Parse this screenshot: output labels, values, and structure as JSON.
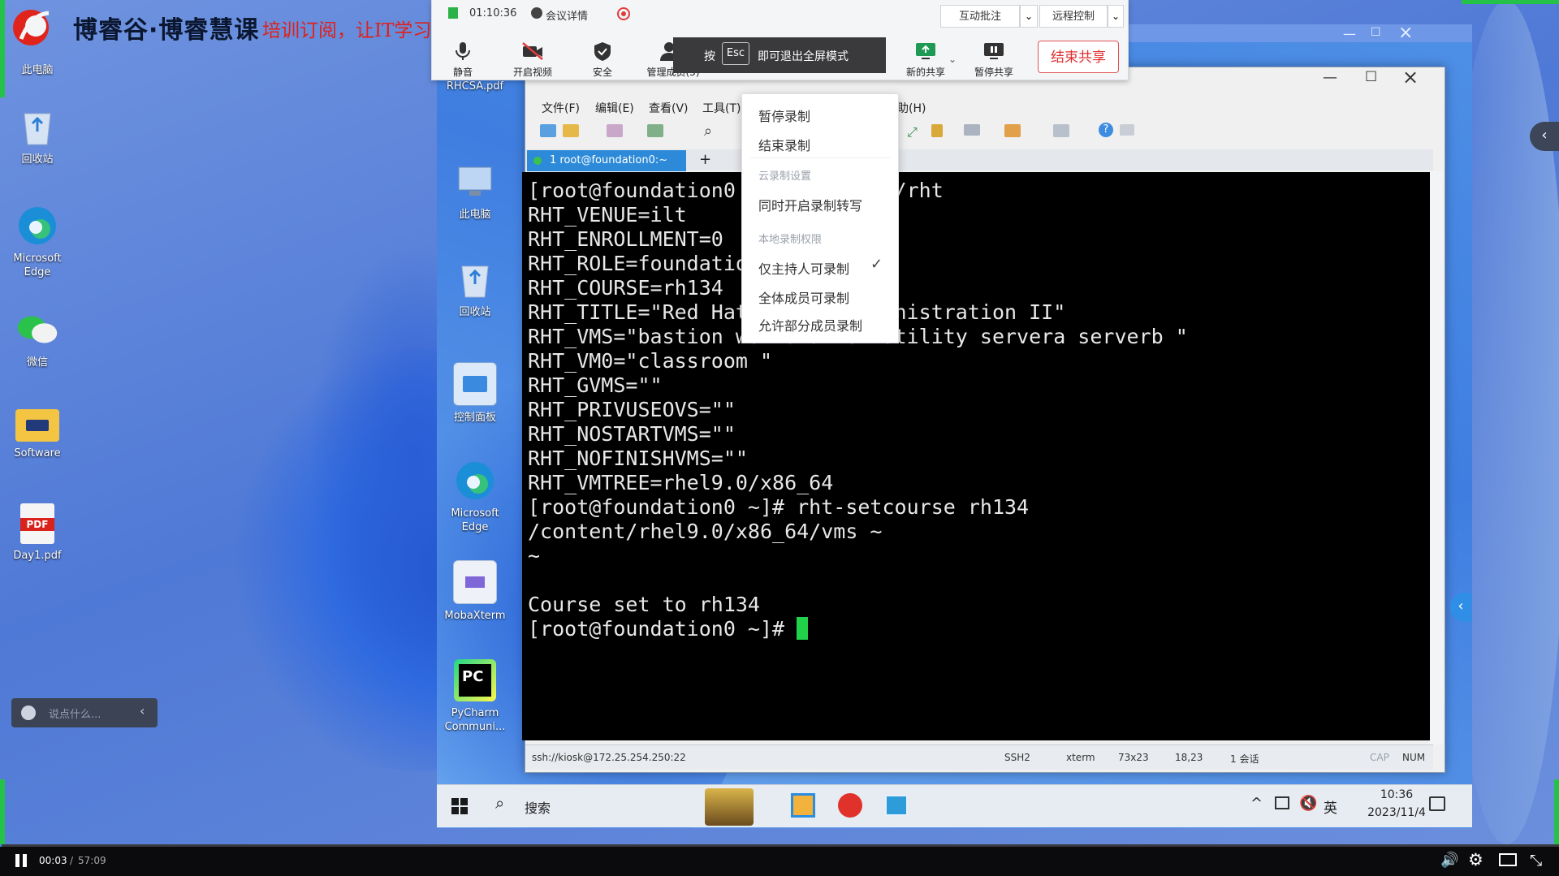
{
  "brand": {
    "name": "博睿谷·博睿慧课",
    "slogan": "培训订阅，让IT学习更普惠便捷"
  },
  "outer_desktop_icons": [
    {
      "label": "此电脑",
      "icon": "computer-icon"
    },
    {
      "label": "回收站",
      "icon": "recycle-bin-icon"
    },
    {
      "label": "Microsoft Edge",
      "icon": "edge-icon"
    },
    {
      "label": "微信",
      "icon": "wechat-icon"
    },
    {
      "label": "Software",
      "icon": "folder-icon"
    },
    {
      "label": "Day1.pdf",
      "icon": "pdf-icon"
    }
  ],
  "chat_bar": {
    "placeholder": "说点什么..."
  },
  "meeting_toolbar": {
    "timer": "01:10:36",
    "meeting_info": "会议详情",
    "buttons": [
      {
        "label": "静音",
        "icon": "microphone-icon"
      },
      {
        "label": "开启视频",
        "icon": "camera-off-icon"
      },
      {
        "label": "安全",
        "icon": "shield-icon"
      },
      {
        "label": "管理成员(3)",
        "icon": "members-icon"
      },
      {
        "label": "新的共享",
        "icon": "share-screen-icon"
      },
      {
        "label": "暂停共享",
        "icon": "pause-share-icon"
      }
    ],
    "annotate_label": "互动批注",
    "remote_control_label": "远程控制",
    "end_share_label": "结束共享",
    "esc_prefix": "按",
    "esc_key": "Esc",
    "esc_suffix": "即可退出全屏模式"
  },
  "vm_desktop_icons": [
    {
      "label": "RHCSA.pdf",
      "icon": "pdf-icon"
    },
    {
      "label": "此电脑",
      "icon": "computer-icon"
    },
    {
      "label": "回收站",
      "icon": "recycle-bin-icon"
    },
    {
      "label": "控制面板",
      "icon": "control-panel-icon"
    },
    {
      "label": "Microsoft Edge",
      "icon": "edge-icon"
    },
    {
      "label": "MobaXterm",
      "icon": "mobaxterm-icon"
    },
    {
      "label": "PyCharm Communi...",
      "icon": "pycharm-icon"
    }
  ],
  "terminal_window": {
    "menus": [
      "文件(F)",
      "编辑(E)",
      "查看(V)",
      "工具(T)",
      "助(H)"
    ],
    "tab_label": "1 root@foundation0:~",
    "lines": [
      "[root@foundation0 ~]# cat /etc/rht",
      "RHT_VENUE=ilt",
      "RHT_ENROLLMENT=0",
      "RHT_ROLE=foundation",
      "RHT_COURSE=rh134",
      "RHT_TITLE=\"Red Hat System Administration II\"",
      "RHT_VMS=\"bastion workstation utility servera serverb \"",
      "RHT_VM0=\"classroom \"",
      "RHT_GVMS=\"\"",
      "RHT_PRIVUSEOVS=\"\"",
      "RHT_NOSTARTVMS=\"\"",
      "RHT_NOFINISHVMS=\"\"",
      "RHT_VMTREE=rhel9.0/x86_64",
      "[root@foundation0 ~]# rht-setcourse rh134",
      "/content/rhel9.0/x86_64/vms ~",
      "~",
      "",
      "Course set to rh134",
      "[root@foundation0 ~]# "
    ],
    "status": {
      "connection": "ssh://kiosk@172.25.254.250:22",
      "protocol": "SSH2",
      "term": "xterm",
      "size": "73x23",
      "cursor": "18,23",
      "sessions": "1 会话",
      "cap": "CAP",
      "num": "NUM"
    }
  },
  "context_menu": {
    "items": [
      {
        "type": "item",
        "label": "暂停录制"
      },
      {
        "type": "item",
        "label": "结束录制"
      },
      {
        "type": "header",
        "label": "云录制设置"
      },
      {
        "type": "item",
        "label": "同时开启录制转写"
      },
      {
        "type": "header",
        "label": "本地录制权限"
      },
      {
        "type": "item",
        "label": "仅主持人可录制",
        "checked": true
      },
      {
        "type": "item",
        "label": "全体成员可录制"
      },
      {
        "type": "item",
        "label": "允许部分成员录制"
      }
    ]
  },
  "vm_taskbar": {
    "search_placeholder": "搜索",
    "ime": "英",
    "time": "10:36",
    "date": "2023/11/4"
  },
  "player": {
    "current_time": "00:03",
    "separator": "/",
    "total_time": "57:09",
    "progress_fraction": 0.001
  }
}
